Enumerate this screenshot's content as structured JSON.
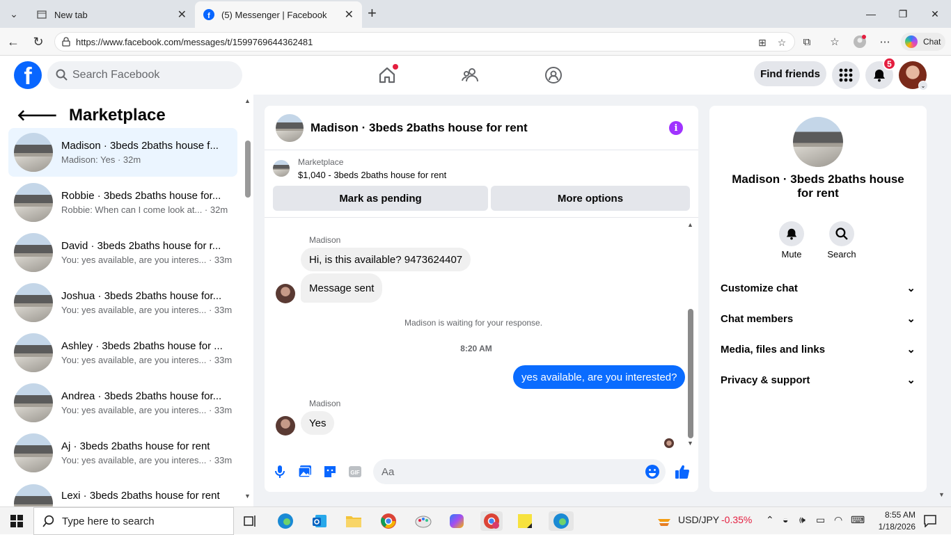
{
  "browser": {
    "tabs": [
      {
        "label": "New tab"
      },
      {
        "label": "(5) Messenger | Facebook"
      }
    ],
    "url": "https://www.facebook.com/messages/t/1599769644362481",
    "chat_button": "Chat"
  },
  "fb_header": {
    "search_placeholder": "Search Facebook",
    "find_friends": "Find friends",
    "notifications_count": "5"
  },
  "left_panel": {
    "title": "Marketplace",
    "conversations": [
      {
        "name": "Madison · 3beds 2baths house f...",
        "msg": "Madison: Yes · 32m"
      },
      {
        "name": "Robbie · 3beds 2baths house for...",
        "msg": "Robbie: When can I come look at... · 32m"
      },
      {
        "name": "David · 3beds 2baths house for r...",
        "msg": "You: yes available, are you interes... · 33m"
      },
      {
        "name": "Joshua · 3beds 2baths house for...",
        "msg": "You: yes available, are you interes... · 33m"
      },
      {
        "name": "Ashley · 3beds 2baths house for ...",
        "msg": "You: yes available, are you interes... · 33m"
      },
      {
        "name": "Andrea · 3beds 2baths house for...",
        "msg": "You: yes available, are you interes... · 33m"
      },
      {
        "name": "Aj · 3beds 2baths house for rent",
        "msg": "You: yes available, are you interes... · 33m"
      },
      {
        "name": "Lexi · 3beds 2baths house for rent",
        "msg": ""
      }
    ]
  },
  "chat": {
    "title": "Madison · 3beds 2baths house for rent",
    "marketplace_label": "Marketplace",
    "listing": "$1,040 - 3beds 2baths house for rent",
    "mark_pending": "Mark as pending",
    "more_options": "More options",
    "sender1": "Madison",
    "msg1": "Hi, is this available? 9473624407",
    "msg2": "Message sent",
    "waiting": "Madison is waiting for your response.",
    "time": "8:20 AM",
    "my_msg": "yes available, are you interested?",
    "sender2": "Madison",
    "msg3": "Yes",
    "composer_placeholder": "Aa"
  },
  "right_panel": {
    "name": "Madison · 3beds 2baths house for rent",
    "mute": "Mute",
    "search": "Search",
    "sections": [
      "Customize chat",
      "Chat members",
      "Media, files and links",
      "Privacy & support"
    ]
  },
  "taskbar": {
    "search_placeholder": "Type here to search",
    "ticker": "USD/JPY",
    "ticker_change": "-0.35%",
    "time": "8:55 AM",
    "date": "1/18/2026"
  },
  "colors": {
    "fb_blue": "#0866ff",
    "message_blue": "#0a6cff",
    "red": "#e41e3f",
    "purple": "#a033ff"
  }
}
